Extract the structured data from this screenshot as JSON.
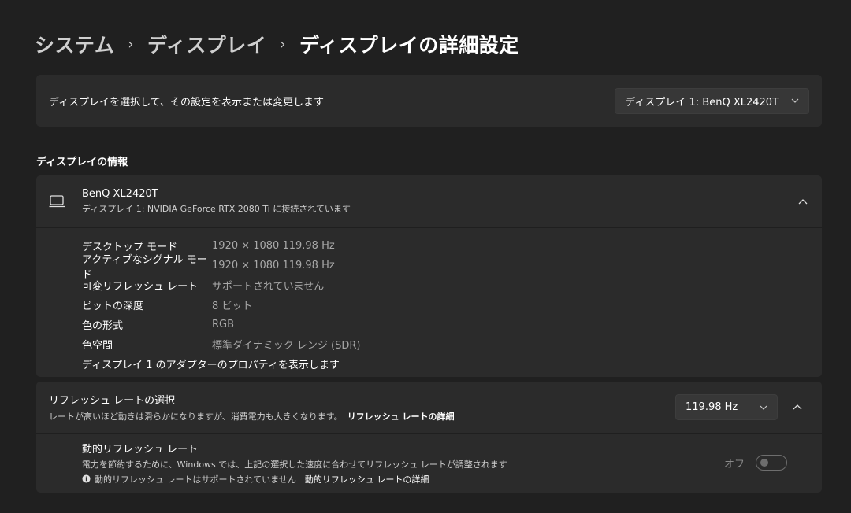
{
  "breadcrumb": {
    "items": [
      "システム",
      "ディスプレイ",
      "ディスプレイの詳細設定"
    ],
    "separator": "›"
  },
  "select_display": {
    "label": "ディスプレイを選択して、その設定を表示または変更します",
    "selected": "ディスプレイ 1: BenQ XL2420T"
  },
  "section_title": "ディスプレイの情報",
  "display_info": {
    "name": "BenQ XL2420T",
    "subtitle": "ディスプレイ 1: NVIDIA GeForce RTX 2080 Ti に接続されています",
    "rows": [
      {
        "key": "デスクトップ モード",
        "value": "1920 × 1080 119.98 Hz"
      },
      {
        "key": "アクティブなシグナル モード",
        "value": "1920 × 1080 119.98 Hz"
      },
      {
        "key": "可変リフレッシュ レート",
        "value": "サポートされていません"
      },
      {
        "key": "ビットの深度",
        "value": "8 ビット"
      },
      {
        "key": "色の形式",
        "value": "RGB"
      },
      {
        "key": "色空間",
        "value": "標準ダイナミック レンジ (SDR)"
      }
    ],
    "adapter_link": "ディスプレイ 1 のアダプターのプロパティを表示します"
  },
  "refresh": {
    "title": "リフレッシュ レートの選択",
    "subtitle": "レートが高いほど動きは滑らかになりますが、消費電力も大きくなります。",
    "details_link": "リフレッシュ レートの詳細",
    "selected_rate": "119.98 Hz",
    "dynamic": {
      "title": "動的リフレッシュ レート",
      "subtitle": "電力を節約するために、Windows では、上記の選択した速度に合わせてリフレッシュ レートが調整されます",
      "note": "動的リフレッシュ レートはサポートされていません",
      "note_link": "動的リフレッシュ レートの詳細",
      "toggle_label": "オフ"
    }
  },
  "icons": {
    "monitor": "monitor-icon",
    "chevron_down": "chevron-down-icon",
    "chevron_up": "chevron-up-icon",
    "info": "info-icon"
  }
}
